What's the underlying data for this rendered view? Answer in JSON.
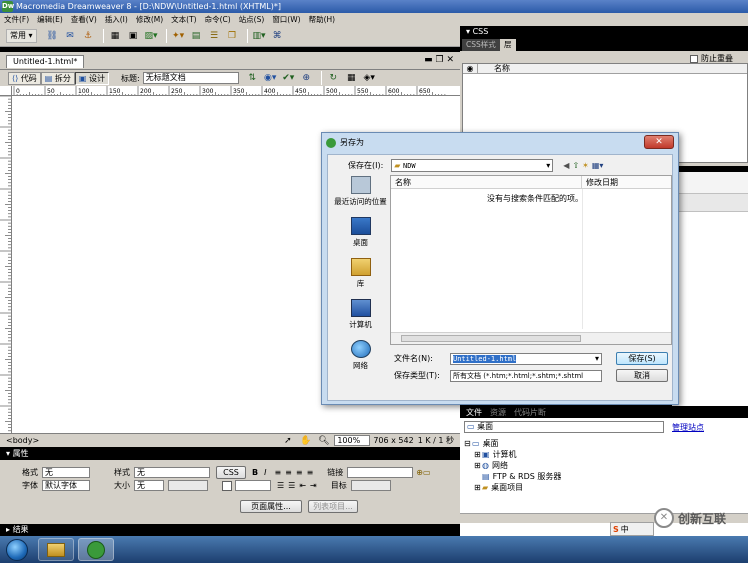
{
  "window": {
    "title": "Macromedia Dreamweaver 8 - [D:\\NDW\\Untitled-1.html (XHTML)*]",
    "app_logo": "Dw"
  },
  "menu": [
    "文件(F)",
    "编辑(E)",
    "查看(V)",
    "插入(I)",
    "修改(M)",
    "文本(T)",
    "命令(C)",
    "站点(S)",
    "窗口(W)",
    "帮助(H)"
  ],
  "insert_toolbar": {
    "category": "常用",
    "icons": [
      "hyperlink-icon",
      "email-icon",
      "anchor-icon",
      "table-icon",
      "div-icon",
      "image-icon",
      "media-icon",
      "date-icon",
      "comment-icon",
      "template-icon",
      "tag-chooser-icon"
    ]
  },
  "document": {
    "tab": "Untitled-1.html*",
    "views": {
      "code": "代码",
      "split": "拆分",
      "design": "设计"
    },
    "title_label": "标题:",
    "title_value": "无标题文档",
    "ruler_marks": [
      "0",
      "50",
      "100",
      "150",
      "200",
      "250",
      "300",
      "350",
      "400",
      "450",
      "500",
      "550",
      "600",
      "650"
    ],
    "status_tag": "<body>",
    "zoom": "100%",
    "size": "706 x 542",
    "file_size": "1 K / 1 秒"
  },
  "properties": {
    "header": "属性",
    "format_label": "格式",
    "format_value": "无",
    "style_label": "样式",
    "style_value": "无",
    "css_btn": "CSS",
    "bold": "B",
    "italic": "I",
    "link_label": "链接",
    "font_label": "字体",
    "font_value": "默认字体",
    "size_label": "大小",
    "size_value": "无",
    "target_label": "目标",
    "page_props_btn": "页面属性...",
    "list_item_btn": "列表项目..."
  },
  "results_header": "结果",
  "css_panel": {
    "header": "CSS",
    "tabs": [
      "CSS样式",
      "层"
    ],
    "prevent_overlap": "防止重叠",
    "column_name": "名称"
  },
  "files_panel": {
    "tabs": [
      "文件",
      "资源",
      "代码片断"
    ],
    "location": "桌面",
    "manage_sites": "管理站点",
    "tree": [
      "桌面",
      "计算机",
      "网络",
      "FTP & RDS 服务器",
      "桌面项目"
    ]
  },
  "dialog": {
    "title": "另存为",
    "save_in_label": "保存在(I):",
    "save_in_value": "NDW",
    "places": [
      "最近访问的位置",
      "桌面",
      "库",
      "计算机",
      "网络"
    ],
    "col_name": "名称",
    "col_date": "修改日期",
    "empty_message": "没有与搜索条件匹配的项。",
    "filename_label": "文件名(N):",
    "filename_value": "Untitled-1.html",
    "filetype_label": "保存类型(T):",
    "filetype_value": "所有文档 (*.htm;*.html;*.shtm;*.shtml",
    "save_btn": "保存(S)",
    "cancel_btn": "取消",
    "close": "✕"
  },
  "tray": {
    "ime": "中",
    "watermark": "创新互联"
  }
}
